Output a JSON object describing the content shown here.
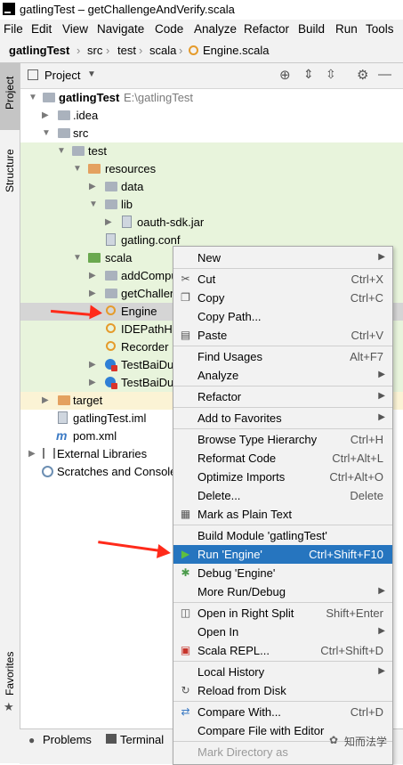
{
  "window": {
    "title": "gatlingTest – getChallengeAndVerify.scala"
  },
  "menubar": [
    "File",
    "Edit",
    "View",
    "Navigate",
    "Code",
    "Analyze",
    "Refactor",
    "Build",
    "Run",
    "Tools"
  ],
  "breadcrumb": [
    "gatlingTest",
    "src",
    "test",
    "scala",
    "Engine.scala"
  ],
  "left_tabs": {
    "project": "Project",
    "structure": "Structure",
    "favorites": "Favorites"
  },
  "project_panel": {
    "title": "Project"
  },
  "tree": [
    {
      "label": "gatlingTest",
      "extra": "E:\\gatlingTest"
    },
    {
      "label": ".idea"
    },
    {
      "label": "src"
    },
    {
      "label": "test"
    },
    {
      "label": "resources"
    },
    {
      "label": "data"
    },
    {
      "label": "lib"
    },
    {
      "label": "oauth-sdk.jar"
    },
    {
      "label": "gatling.conf"
    },
    {
      "label": "scala"
    },
    {
      "label": "addCompu"
    },
    {
      "label": "getChallen"
    },
    {
      "label": "Engine"
    },
    {
      "label": "IDEPathHe"
    },
    {
      "label": "Recorder"
    },
    {
      "label": "TestBaiDu"
    },
    {
      "label": "TestBaiDu"
    },
    {
      "label": "target"
    },
    {
      "label": "gatlingTest.iml"
    },
    {
      "label": "pom.xml"
    },
    {
      "label": "External Libraries"
    },
    {
      "label": "Scratches and Console"
    }
  ],
  "bottom_tabs": {
    "problems": "Problems",
    "terminal": "Terminal"
  },
  "watermark": "知而法学",
  "context_menu": [
    {
      "label": "New",
      "shortcut": ""
    },
    {
      "label": "Cut",
      "shortcut": "Ctrl+X"
    },
    {
      "label": "Copy",
      "shortcut": "Ctrl+C"
    },
    {
      "label": "Copy Path...",
      "shortcut": ""
    },
    {
      "label": "Paste",
      "shortcut": "Ctrl+V"
    },
    {
      "label": "Find Usages",
      "shortcut": "Alt+F7"
    },
    {
      "label": "Analyze",
      "shortcut": ""
    },
    {
      "label": "Refactor",
      "shortcut": ""
    },
    {
      "label": "Add to Favorites",
      "shortcut": ""
    },
    {
      "label": "Browse Type Hierarchy",
      "shortcut": "Ctrl+H"
    },
    {
      "label": "Reformat Code",
      "shortcut": "Ctrl+Alt+L"
    },
    {
      "label": "Optimize Imports",
      "shortcut": "Ctrl+Alt+O"
    },
    {
      "label": "Delete...",
      "shortcut": "Delete"
    },
    {
      "label": "Mark as Plain Text",
      "shortcut": ""
    },
    {
      "label": "Build Module 'gatlingTest'",
      "shortcut": ""
    },
    {
      "label": "Run 'Engine'",
      "shortcut": "Ctrl+Shift+F10"
    },
    {
      "label": "Debug 'Engine'",
      "shortcut": ""
    },
    {
      "label": "More Run/Debug",
      "shortcut": ""
    },
    {
      "label": "Open in Right Split",
      "shortcut": "Shift+Enter"
    },
    {
      "label": "Open In",
      "shortcut": ""
    },
    {
      "label": "Scala REPL...",
      "shortcut": "Ctrl+Shift+D"
    },
    {
      "label": "Local History",
      "shortcut": ""
    },
    {
      "label": "Reload from Disk",
      "shortcut": ""
    },
    {
      "label": "Compare With...",
      "shortcut": "Ctrl+D"
    },
    {
      "label": "Compare File with Editor",
      "shortcut": ""
    },
    {
      "label": "Mark Directory as",
      "shortcut": ""
    }
  ],
  "colors": {
    "selection": "#2675bf",
    "test_folder_bg": "#e8f4dc",
    "arrow": "#ff2a1a"
  }
}
